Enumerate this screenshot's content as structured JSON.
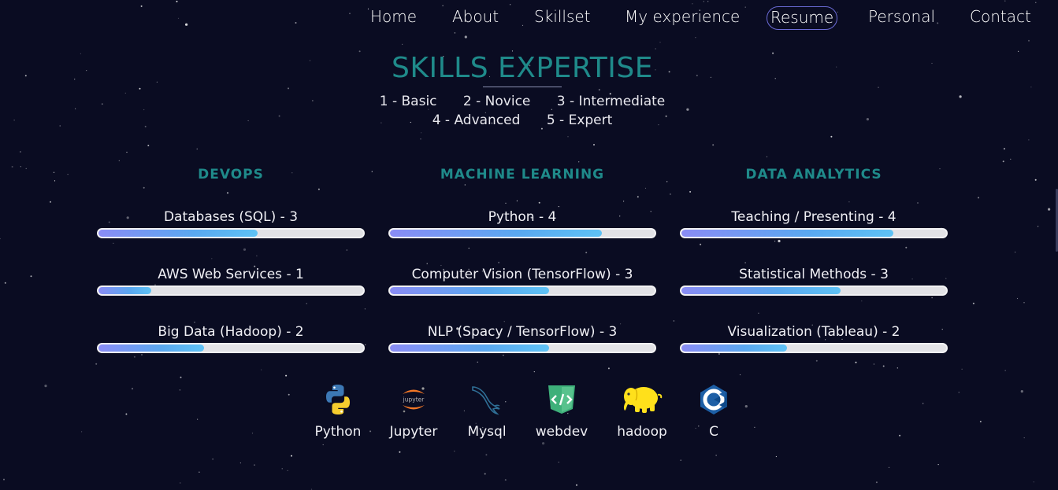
{
  "nav": {
    "items": [
      {
        "label": "Home",
        "active": false
      },
      {
        "label": "About",
        "active": false
      },
      {
        "label": "Skillset",
        "active": false
      },
      {
        "label": "My experience",
        "active": false
      },
      {
        "label": "Resume",
        "active": true
      },
      {
        "label": "Personal",
        "active": false
      },
      {
        "label": "Contact",
        "active": false
      }
    ]
  },
  "section": {
    "title": "SKILLS EXPERTISE",
    "levels": [
      "1 - Basic",
      "2 - Novice",
      "3 - Intermediate",
      "4 - Advanced",
      "5 - Expert"
    ]
  },
  "columns": [
    {
      "heading": "DEVOPS",
      "skills": [
        {
          "label": "Databases (SQL) - 3",
          "level": 3
        },
        {
          "label": "AWS Web Services - 1",
          "level": 1
        },
        {
          "label": "Big Data (Hadoop) - 2",
          "level": 2
        }
      ]
    },
    {
      "heading": "MACHINE LEARNING",
      "skills": [
        {
          "label": "Python - 4",
          "level": 4
        },
        {
          "label": "Computer Vision (TensorFlow) - 3",
          "level": 3
        },
        {
          "label": "NLP (Spacy / TensorFlow) - 3",
          "level": 3
        }
      ]
    },
    {
      "heading": "DATA ANALYTICS",
      "skills": [
        {
          "label": "Teaching / Presenting - 4",
          "level": 4
        },
        {
          "label": "Statistical Methods - 3",
          "level": 3
        },
        {
          "label": "Visualization (Tableau) - 2",
          "level": 2
        }
      ]
    }
  ],
  "tools": [
    {
      "label": "Python",
      "icon": "python-icon"
    },
    {
      "label": "Jupyter",
      "icon": "jupyter-icon"
    },
    {
      "label": "Mysql",
      "icon": "mysql-dolphin-icon"
    },
    {
      "label": "webdev",
      "icon": "code-brackets-icon"
    },
    {
      "label": "hadoop",
      "icon": "hadoop-elephant-icon"
    },
    {
      "label": "C",
      "icon": "c-language-icon"
    }
  ],
  "colors": {
    "background": "#0a0c22",
    "accent_heading": "#1f8a8a",
    "nav_active_border": "#6b6bd6",
    "bar_track": "#e2e2e6",
    "bar_fill_start": "#8a8cf5",
    "bar_fill_end": "#5ec2f5"
  }
}
